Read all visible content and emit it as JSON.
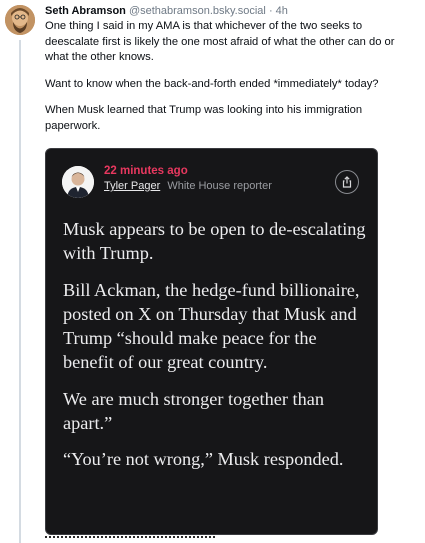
{
  "post": {
    "author_name": "Seth Abramson",
    "author_handle": "@sethabramson.bsky.social",
    "separator": "·",
    "time": "4h",
    "paragraphs": [
      "One thing I said in my AMA is that whichever of the two seeks to deescalate first is likely the one most afraid of what the other can do or what the other knows.",
      "Want to know when the back-and-forth ended *immediately* today?",
      "When Musk learned that Trump was looking into his immigration paperwork."
    ]
  },
  "embed": {
    "timestamp": "22 minutes ago",
    "reporter_name": "Tyler Pager",
    "reporter_role": "White House reporter",
    "share_icon": "share-icon",
    "paragraphs": [
      "Musk appears to be open to de-escalating with Trump.",
      "Bill Ackman, the hedge-fund billionaire, posted on X on Thursday that Musk and Trump “should make peace for the benefit of our great country.",
      "We are much stronger together than apart.”",
      "“You’re not wrong,” Musk responded."
    ],
    "colors": {
      "background": "#161618",
      "timestamp": "#e8385f",
      "text": "#ececee"
    }
  }
}
